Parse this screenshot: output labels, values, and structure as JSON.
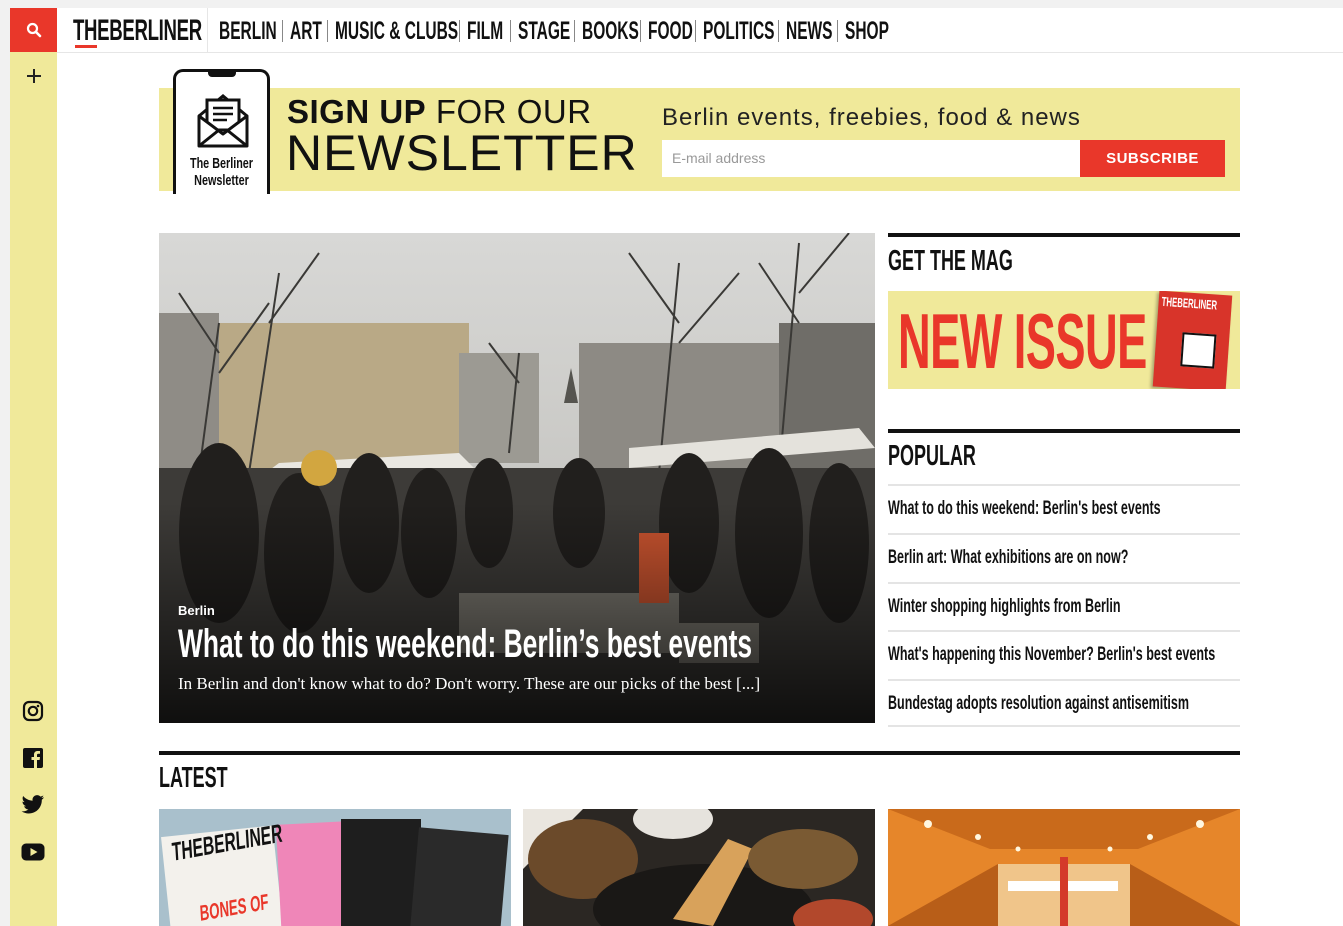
{
  "brand": {
    "logo": "THEBERLINER",
    "accent": "#e9372a",
    "yellow": "#f0e99a"
  },
  "sidebar": {
    "search_icon": "search-icon",
    "add_icon": "plus-icon",
    "social": [
      "instagram-icon",
      "facebook-icon",
      "twitter-icon",
      "youtube-icon"
    ]
  },
  "nav": {
    "items": [
      "BERLIN",
      "ART",
      "MUSIC & CLUBS",
      "FILM",
      "STAGE",
      "BOOKS",
      "FOOD",
      "POLITICS",
      "NEWS",
      "SHOP"
    ]
  },
  "newsletter": {
    "badge_line1": "The Berliner",
    "badge_line2": "Newsletter",
    "title_bold": "SIGN UP",
    "title_rest": " FOR OUR",
    "title_big": "NEWSLETTER",
    "tagline": "Berlin events, freebies, food & news",
    "email_placeholder": "E-mail address",
    "subscribe": "SUBSCRIBE"
  },
  "hero": {
    "category": "Berlin",
    "title": "What to do this weekend: Berlin’s best events",
    "excerpt": "In Berlin and don't know what to do? Don't worry. These are our picks of the best [...]"
  },
  "mag": {
    "heading": "GET THE MAG",
    "banner": "NEW ISSUE",
    "cover_logo": "THEBERLINER"
  },
  "popular": {
    "heading": "POPULAR",
    "items": [
      "What to do this weekend: Berlin's best events",
      "Berlin art: What exhibitions are on now?",
      "Winter shopping highlights from Berlin",
      "What's happening this November? Berlin's best events",
      "Bundestag adopts resolution against antisemitism"
    ]
  },
  "latest": {
    "heading": "LATEST",
    "card1_text": "THEBERLINER",
    "card1_sub": "BONES OF"
  }
}
